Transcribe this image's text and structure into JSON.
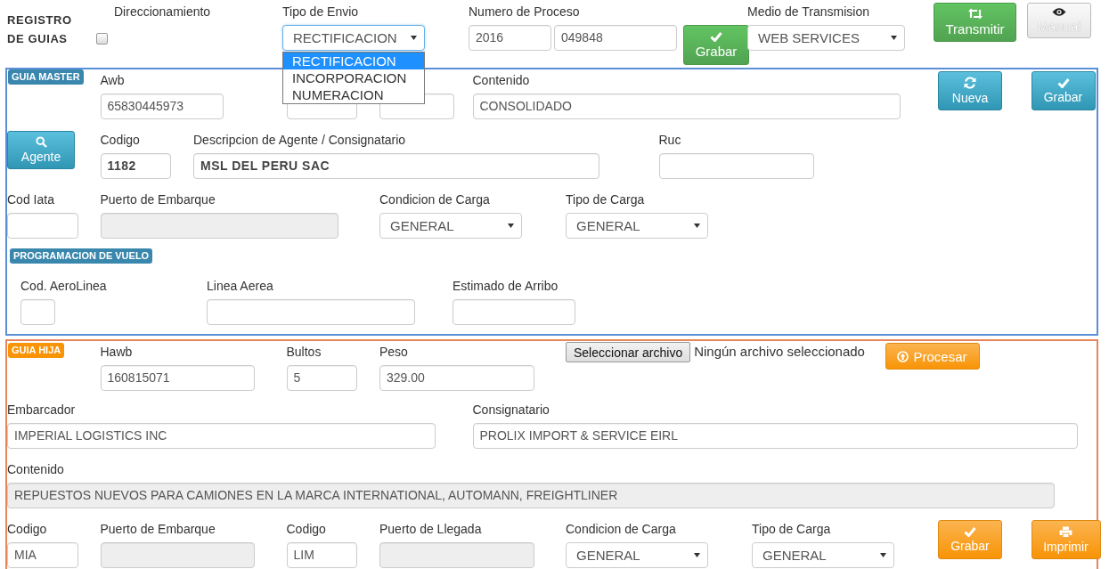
{
  "header": {
    "title": "REGISTRO DE GUIAS",
    "direccionamiento": {
      "label": "Direccionamiento",
      "checked": false
    },
    "tipo_envio": {
      "label": "Tipo de Envio",
      "value": "RECTIFICACION",
      "expanded": true,
      "options": [
        {
          "label": "RECTIFICACION",
          "selected": true
        },
        {
          "label": "INCORPORACION",
          "selected": false
        },
        {
          "label": "NUMERACION",
          "selected": false
        }
      ]
    },
    "numero_proceso": {
      "label": "Numero de Proceso",
      "year": "2016",
      "number": "049848"
    },
    "save_button": {
      "label": "Grabar",
      "kind": "save"
    },
    "medio_transmision": {
      "label": "Medio de Transmision",
      "value": "WEB SERVICES"
    },
    "buttons": [
      {
        "label": "Transmitir",
        "kind": "transmit",
        "disabled": false
      },
      {
        "label": "Manual",
        "kind": "view",
        "disabled": true
      }
    ]
  },
  "guia_master": {
    "badge": "GUIA MASTER",
    "rows": [
      [
        "",
        {
          "kind": "input",
          "label": "Awb",
          "value": "65830445973",
          "disabled": false
        },
        {
          "kind": "input",
          "disabled": false
        },
        {
          "kind": "input",
          "disabled": false
        },
        {
          "kind": "input",
          "label": "Contenido",
          "value": "CONSOLIDADO",
          "disabled": false
        },
        {
          "kind": "new",
          "label": "Nueva"
        },
        {
          "kind": "save",
          "label": "Grabar"
        }
      ],
      [
        {
          "kind": "search",
          "label": "Agente"
        },
        {
          "kind": "input",
          "label": "Codigo",
          "value": "1182",
          "disabled": false
        },
        {
          "kind": "input",
          "label": "Descripcion de Agente / Consignatario",
          "value": "MSL DEL PERU SAC",
          "disabled": false
        },
        {
          "kind": "input",
          "label": "Ruc",
          "disabled": false
        }
      ],
      [
        {
          "kind": "input",
          "label": "Cod Iata",
          "disabled": false
        },
        {
          "kind": "input",
          "label": "Puerto de Embarque",
          "disabled": true
        },
        {
          "kind": "select",
          "label": "Condicion de Carga",
          "value": "GENERAL"
        },
        {
          "kind": "select",
          "label": "Tipo de Carga",
          "value": "GENERAL"
        }
      ]
    ],
    "subsection": {
      "badge": "PROGRAMACION DE VUELO",
      "rows": [
        [
          {
            "kind": "input",
            "label": "Cod. AeroLinea",
            "disabled": false
          },
          {
            "kind": "input",
            "label": "Linea Aerea",
            "disabled": false
          },
          {
            "kind": "input",
            "label": "Estimado de Arribo",
            "disabled": false
          }
        ]
      ]
    }
  },
  "guia_hija": {
    "badge": "GUIA HIJA",
    "rows": [
      [
        "",
        {
          "kind": "input",
          "label": "Hawb",
          "value": "160815071",
          "disabled": false
        },
        {
          "kind": "input",
          "label": "Bultos",
          "value": "5",
          "disabled": false
        },
        {
          "kind": "input",
          "label": "Peso",
          "value": "329.00",
          "disabled": false
        },
        {
          "kind": "file",
          "button": "Seleccionar archivo",
          "status": "Ningún archivo seleccionado"
        },
        "",
        {
          "kind": "process",
          "label": "Procesar"
        }
      ],
      [
        {
          "kind": "input",
          "label": "Embarcador",
          "value": "IMPERIAL LOGISTICS INC",
          "disabled": false
        },
        {
          "kind": "input",
          "label": "Consignatario",
          "value": "PROLIX IMPORT & SERVICE EIRL",
          "disabled": false
        }
      ],
      [
        {
          "kind": "input",
          "label": "Contenido",
          "value": "REPUESTOS NUEVOS PARA CAMIONES EN LA MARCA INTERNATIONAL, AUTOMANN, FREIGHTLINER",
          "disabled": true
        }
      ],
      [
        {
          "kind": "input",
          "label": "Codigo",
          "value": "MIA",
          "disabled": false
        },
        {
          "kind": "input",
          "label": "Puerto de Embarque",
          "disabled": true
        },
        {
          "kind": "input",
          "label": "Codigo",
          "value": "LIM",
          "disabled": false
        },
        {
          "kind": "input",
          "label": "Puerto de Llegada",
          "disabled": true
        },
        {
          "kind": "select",
          "label": "Condicion de Carga",
          "value": "GENERAL"
        },
        {
          "kind": "select",
          "label": "Tipo de Carga",
          "value": "GENERAL"
        },
        {
          "kind": "save",
          "label": "Grabar"
        },
        {
          "kind": "print",
          "label": "Imprimir"
        }
      ]
    ]
  }
}
